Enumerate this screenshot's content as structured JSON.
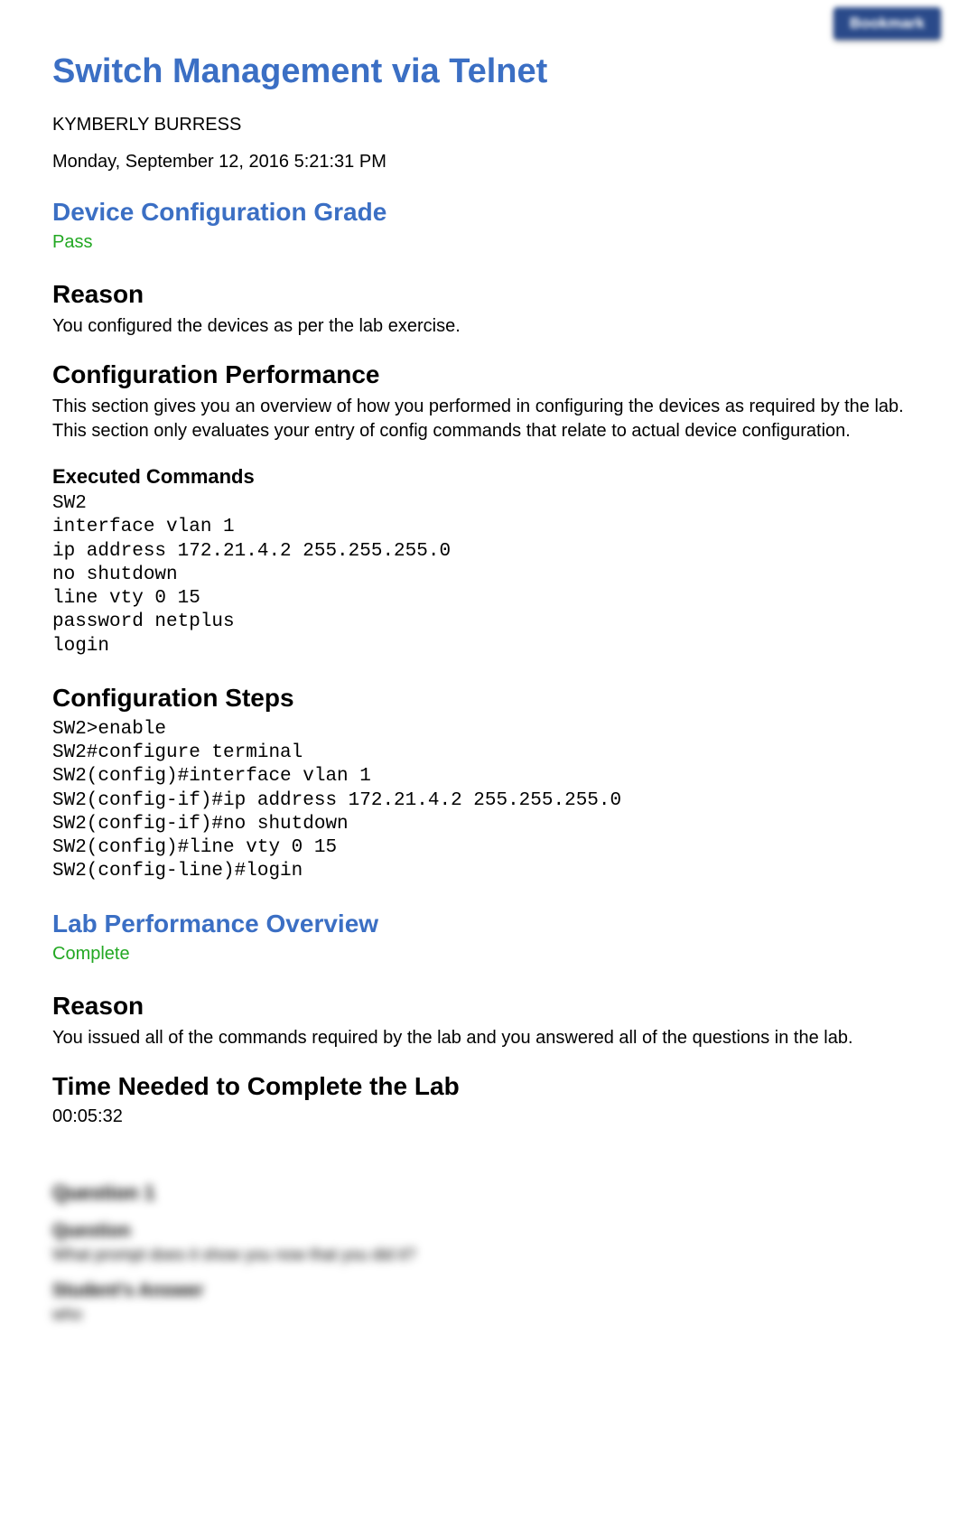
{
  "top_button_label": "Bookmark",
  "page_title": "Switch Management via Telnet",
  "author": "KYMBERLY BURRESS",
  "date": "Monday, September 12, 2016 5:21:31 PM",
  "grade_section": {
    "title": "Device Configuration Grade",
    "status": "Pass"
  },
  "reason1": {
    "title": "Reason",
    "text": "You configured the devices as per the lab exercise."
  },
  "config_perf": {
    "title": "Configuration Performance",
    "text": "This section gives you an overview of how you performed in configuring the devices as required by the lab. This section only evaluates your entry of config commands that relate to actual device configuration."
  },
  "executed": {
    "title": "Executed Commands",
    "code": "SW2\ninterface vlan 1\nip address 172.21.4.2 255.255.255.0\nno shutdown\nline vty 0 15\npassword netplus\nlogin"
  },
  "steps": {
    "title": "Configuration Steps",
    "code": "SW2>enable\nSW2#configure terminal\nSW2(config)#interface vlan 1\nSW2(config-if)#ip address 172.21.4.2 255.255.255.0\nSW2(config-if)#no shutdown\nSW2(config)#line vty 0 15\nSW2(config-line)#login"
  },
  "lab_perf": {
    "title": "Lab Performance Overview",
    "status": "Complete"
  },
  "reason2": {
    "title": "Reason",
    "text": "You issued all of the commands required by the lab and you answered all of the questions in the lab."
  },
  "time": {
    "title": "Time Needed to Complete the Lab",
    "value": "00:05:32"
  },
  "blurred_question": {
    "num": "Question 1",
    "q_label": "Question",
    "q_text": "What prompt does it show you now that you did it?",
    "a_label": "Student's Answer",
    "a_text": "who"
  }
}
